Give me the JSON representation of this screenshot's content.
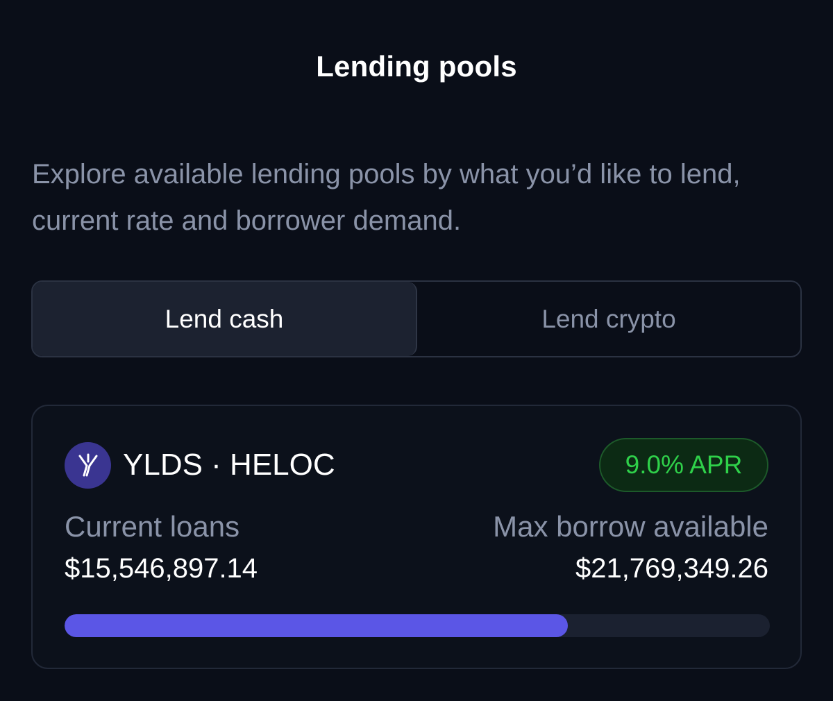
{
  "header": {
    "title": "Lending pools"
  },
  "intro": {
    "text": "Explore available lending pools by what you’d like to lend, current rate and borrower demand."
  },
  "tabs": [
    {
      "label": "Lend cash",
      "selected": true
    },
    {
      "label": "Lend crypto",
      "selected": false
    }
  ],
  "pool": {
    "icon": "yields-logo-icon",
    "name": "YLDS · HELOC",
    "apr": "9.0% APR",
    "current_loans_label": "Current loans",
    "current_loans_value": "$15,546,897.14",
    "max_borrow_label": "Max borrow available",
    "max_borrow_value": "$21,769,349.26",
    "utilization_fraction": 0.714
  },
  "colors": {
    "background": "#0a0e18",
    "accent": "#5b56e6",
    "apr_green": "#2fd14a",
    "muted_text": "#8a93a8"
  }
}
